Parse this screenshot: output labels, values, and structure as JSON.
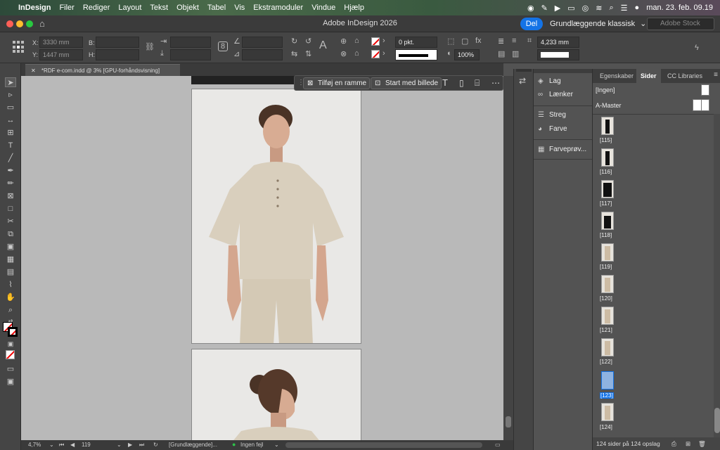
{
  "menubar": {
    "app": "InDesign",
    "items": [
      "Filer",
      "Rediger",
      "Layout",
      "Tekst",
      "Objekt",
      "Tabel",
      "Vis",
      "Ekstramoduler",
      "Vindue",
      "Hjælp"
    ],
    "clock": "man. 23. feb.  09.19"
  },
  "window": {
    "title": "Adobe InDesign 2026",
    "share_label": "Del",
    "workspace": "Grundlæggende klassisk",
    "stock_placeholder": "Adobe Stock"
  },
  "control": {
    "x_label": "X:",
    "x_value": "3330 mm",
    "y_label": "Y:",
    "y_value": "1447 mm",
    "w_label": "B:",
    "h_label": "H:",
    "stroke_weight": "0 pkt.",
    "zoom_pct": "100%",
    "gap_value": "4,233 mm"
  },
  "document": {
    "tab_label": "*RDF e-com.indd @ 3% [GPU-forhåndsvisning]"
  },
  "context": {
    "add_frame": "Tilføj en ramme",
    "start_image": "Start med billede"
  },
  "midpanel": {
    "items": [
      "Lag",
      "Lænker",
      "Streg",
      "Farve",
      "Farveprøv..."
    ]
  },
  "pages_panel": {
    "tabs": [
      "Egenskaber",
      "Sider",
      "CC Libraries"
    ],
    "masters": [
      "[Ingen]",
      "A-Master"
    ],
    "thumbs": [
      "[115]",
      "[116]",
      "[117]",
      "[118]",
      "[119]",
      "[120]",
      "[121]",
      "[122]",
      "[123]",
      "[124]"
    ],
    "selected": "[123]",
    "footer": "124 sider på 124 opslag"
  },
  "status": {
    "zoom": "4,7%",
    "page": "119",
    "master": "[Grundlæggende]...",
    "preflight": "Ingen fejl"
  },
  "colors": {
    "accent": "#1473e6",
    "panel": "#535353",
    "canvas": "#b9b9b9"
  }
}
